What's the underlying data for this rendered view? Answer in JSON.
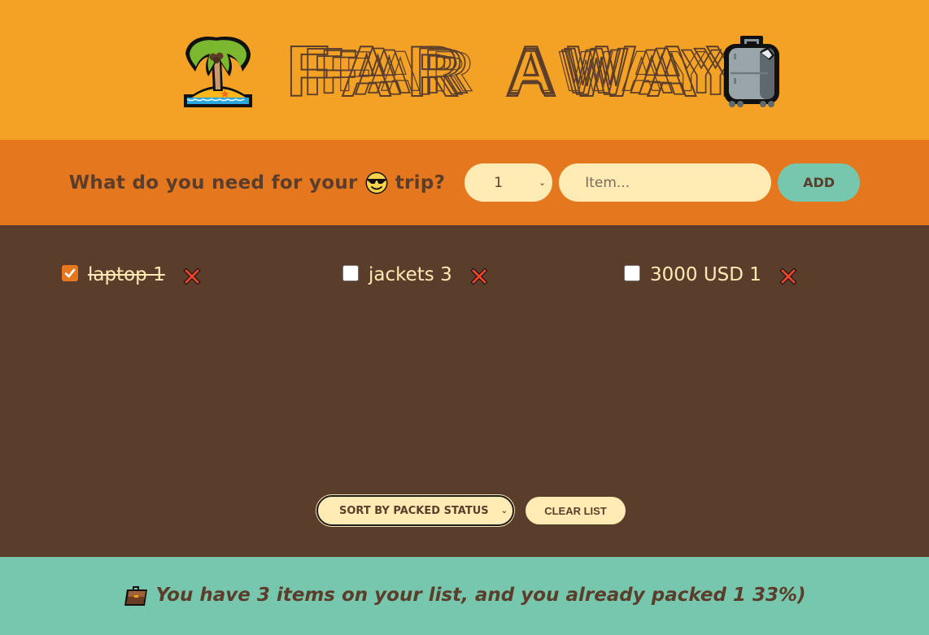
{
  "header": {
    "title": "Far Away",
    "left_icon": "palm-tree-island-icon",
    "right_icon": "luggage-icon"
  },
  "form": {
    "question_prefix": "What do you need for your",
    "question_icon": "smiling-face-with-sunglasses-icon",
    "question_suffix": "trip?",
    "quantity": {
      "selected": "1"
    },
    "item_input": {
      "value": "",
      "placeholder": "Item..."
    },
    "add_label": "Add"
  },
  "list": {
    "items": [
      {
        "description": "laptop",
        "quantity": "1",
        "packed": true,
        "label": "laptop 1"
      },
      {
        "description": "jackets",
        "quantity": "3",
        "packed": false,
        "label": "jackets 3"
      },
      {
        "description": "3000 USD",
        "quantity": "1",
        "packed": false,
        "label": "3000 USD 1"
      }
    ],
    "delete_icon": "cross-mark-icon"
  },
  "actions": {
    "sort": {
      "selected": "Sort by packed status"
    },
    "clear_label": "Clear list"
  },
  "stats": {
    "icon": "briefcase-icon",
    "text": "You have 3 items on your list, and you already packed 1 33%)",
    "total_items": 3,
    "packed_items": 1,
    "packed_percent": 33
  },
  "colors": {
    "header_bg": "#f4a226",
    "form_bg": "#e5771e",
    "list_bg": "#5a3e2b",
    "stats_bg": "#76c7ad",
    "cream": "#ffebb3",
    "brown": "#5a3e2b"
  }
}
